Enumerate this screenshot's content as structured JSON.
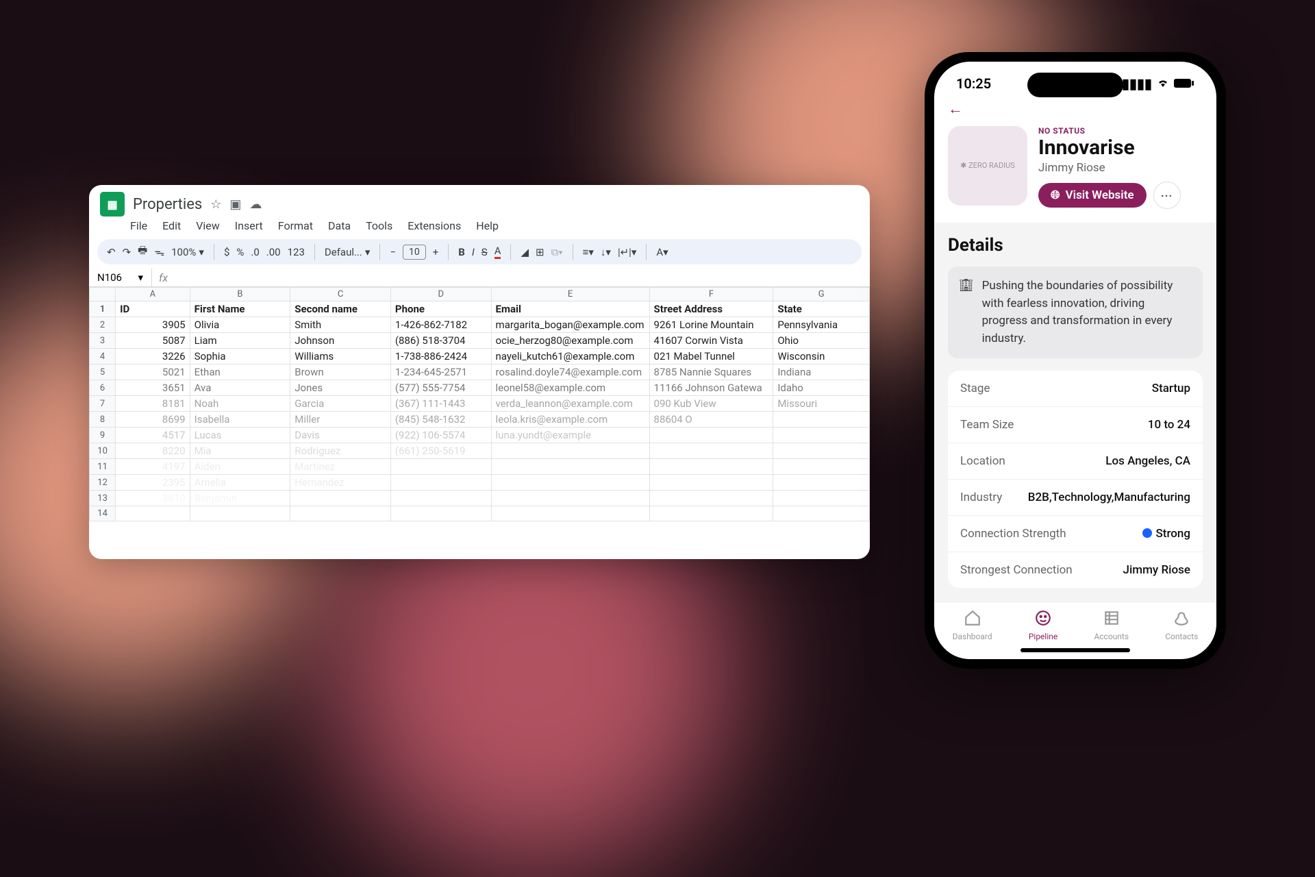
{
  "sheet": {
    "title": "Properties",
    "menus": [
      "File",
      "Edit",
      "View",
      "Insert",
      "Format",
      "Data",
      "Tools",
      "Extensions",
      "Help"
    ],
    "toolbar": {
      "zoom": "100%",
      "currency": "$",
      "percent": "%",
      "dec_dec": ".0",
      "dec_inc": ".00",
      "num123": "123",
      "font": "Defaul...",
      "font_size": "10"
    },
    "cell_ref": "N106",
    "columns": [
      "A",
      "B",
      "C",
      "D",
      "E",
      "F",
      "G"
    ],
    "headers": [
      "ID",
      "First Name",
      "Second name",
      "Phone",
      "Email",
      "Street Address",
      "State"
    ],
    "rows": [
      {
        "n": 1
      },
      {
        "n": 2,
        "id": "3905",
        "fn": "Olivia",
        "sn": "Smith",
        "ph": "1-426-862-7182",
        "em": "margarita_bogan@example.com",
        "ad": "9261 Lorine Mountain",
        "st": "Pennsylvania",
        "fade": ""
      },
      {
        "n": 3,
        "id": "5087",
        "fn": "Liam",
        "sn": "Johnson",
        "ph": "(886) 518-3704",
        "em": "ocie_herzog80@example.com",
        "ad": "41607 Corwin Vista",
        "st": "Ohio",
        "fade": ""
      },
      {
        "n": 4,
        "id": "3226",
        "fn": "Sophia",
        "sn": "Williams",
        "ph": "1-738-886-2424",
        "em": "nayeli_kutch61@example.com",
        "ad": "021 Mabel Tunnel",
        "st": "Wisconsin",
        "fade": ""
      },
      {
        "n": 5,
        "id": "5021",
        "fn": "Ethan",
        "sn": "Brown",
        "ph": "1-234-645-2571",
        "em": "rosalind.doyle74@example.com",
        "ad": "8785 Nannie Squares",
        "st": "Indiana",
        "fade": "fade1"
      },
      {
        "n": 6,
        "id": "3651",
        "fn": "Ava",
        "sn": "Jones",
        "ph": "(577) 555-7754",
        "em": "leonel58@example.com",
        "ad": "11166 Johnson Gatewa",
        "st": "Idaho",
        "fade": "fade1"
      },
      {
        "n": 7,
        "id": "8181",
        "fn": "Noah",
        "sn": "Garcia",
        "ph": "(367) 111-1443",
        "em": "verda_leannon@example.com",
        "ad": "090 Kub View",
        "st": "Missouri",
        "fade": "fade2"
      },
      {
        "n": 8,
        "id": "8699",
        "fn": "Isabella",
        "sn": "Miller",
        "ph": "(845) 548-1632",
        "em": "leola.kris@example.com",
        "ad": "88604 O",
        "st": "",
        "fade": "fade2"
      },
      {
        "n": 9,
        "id": "4517",
        "fn": "Lucas",
        "sn": "Davis",
        "ph": "(922) 106-5574",
        "em": "luna.yundt@example",
        "ad": "",
        "st": "",
        "fade": "fade3"
      },
      {
        "n": 10,
        "id": "8220",
        "fn": "Mia",
        "sn": "Rodriguez",
        "ph": "(661) 250-5619",
        "em": "",
        "ad": "",
        "st": "",
        "fade": "fade4"
      },
      {
        "n": 11,
        "id": "4197",
        "fn": "Aiden",
        "sn": "Martinez",
        "ph": "",
        "em": "",
        "ad": "",
        "st": "",
        "fade": "fade5"
      },
      {
        "n": 12,
        "id": "2395",
        "fn": "Amelia",
        "sn": "Hernandez",
        "ph": "",
        "em": "",
        "ad": "",
        "st": "",
        "fade": "fade5"
      },
      {
        "n": 13,
        "id": "3810",
        "fn": "Benjamin",
        "sn": "",
        "ph": "",
        "em": "",
        "ad": "",
        "st": "",
        "fade": "fade6"
      },
      {
        "n": 14,
        "id": "",
        "fn": "",
        "sn": "",
        "ph": "",
        "em": "",
        "ad": "",
        "st": "",
        "fade": "fade6"
      }
    ]
  },
  "phone": {
    "time": "10:25",
    "status_label": "NO STATUS",
    "company": "Innovarise",
    "person": "Jimmy Riose",
    "avatar_label": "ZERO RADIUS",
    "visit_label": "Visit Website",
    "details_title": "Details",
    "description": "Pushing the boundaries of possibility with fearless innovation, driving progress and transformation in every industry.",
    "info": [
      {
        "label": "Stage",
        "value": "Startup",
        "dot": false
      },
      {
        "label": "Team Size",
        "value": "10 to 24",
        "dot": false
      },
      {
        "label": "Location",
        "value": "Los Angeles, CA",
        "dot": false
      },
      {
        "label": "Industry",
        "value": "B2B,Technology,Manufacturing",
        "dot": false
      },
      {
        "label": "Connection Strength",
        "value": "Strong",
        "dot": true
      },
      {
        "label": "Strongest Connection",
        "value": "Jimmy Riose",
        "dot": false
      }
    ],
    "tabs": [
      {
        "label": "Dashboard",
        "active": false
      },
      {
        "label": "Pipeline",
        "active": true
      },
      {
        "label": "Accounts",
        "active": false
      },
      {
        "label": "Contacts",
        "active": false
      }
    ]
  }
}
